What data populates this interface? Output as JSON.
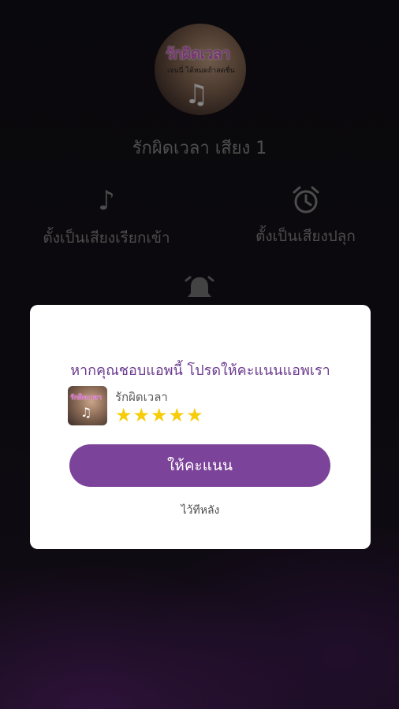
{
  "player": {
    "cover_title": "รักผิดเวลา",
    "cover_subtitle": "เจนนี่ ได้หมดถ้าสดชื่น",
    "song_title": "รักผิดเวลา เสียง 1",
    "actions": [
      {
        "label": "ตั้งเป็นเสียงเรียกเข้า",
        "icon": "music-note-icon"
      },
      {
        "label": "ตั้งเป็นเสียงปลุก",
        "icon": "alarm-clock-icon"
      },
      {
        "icon": "bell-icon"
      }
    ]
  },
  "dialog": {
    "title": "หากคุณชอบแอพนี้ โปรดให้คะแนนแอพเรา",
    "app_name": "รักผิดเวลา",
    "stars": "★★★★★",
    "rate_label": "ให้คะแนน",
    "later_label": "ไว้ทีหลัง"
  },
  "colors": {
    "accent": "#7b4399",
    "title": "#6b3a8e",
    "star": "#f7cd0a"
  }
}
